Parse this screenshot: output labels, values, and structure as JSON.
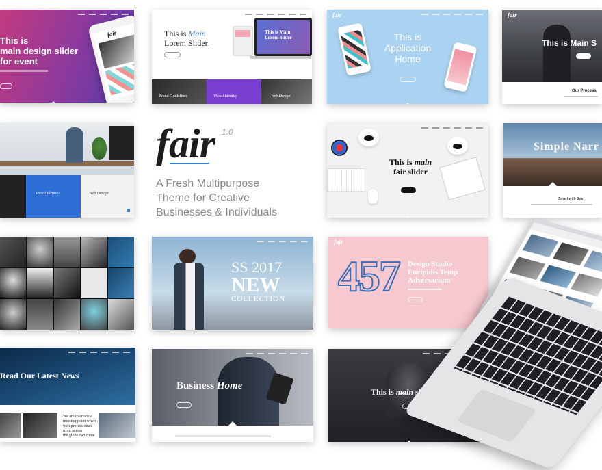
{
  "brand": {
    "name": "fair",
    "version": "1.0",
    "tagline_lines": [
      "A Fresh Multipurpose",
      "Theme for Creative",
      "Businesses & Individuals"
    ]
  },
  "tiles": {
    "t1": {
      "heading_lines": [
        "This is",
        "main design slider",
        "for event"
      ],
      "logo": "fair"
    },
    "t2": {
      "heading_plain": "This is ",
      "heading_italic": "Main",
      "heading_line2": "Lorem Slider_",
      "inner_heading_lines": [
        "This is Main",
        "Lorem Slider"
      ],
      "cards": [
        "Brand Guidelines",
        "Visual Identity",
        "Web Design"
      ]
    },
    "t3": {
      "heading_lines": [
        "This is",
        "Application",
        "Home"
      ],
      "logo": "fair"
    },
    "t4": {
      "heading": "This is Main S",
      "section": "Our Process",
      "logo": "fair"
    },
    "t5": {
      "cards": [
        "Visual Identity",
        "Web Design"
      ]
    },
    "t7": {
      "heading_plain": "This is ",
      "heading_italic": "main",
      "heading_line2": "fair slider"
    },
    "t8": {
      "heading": "Simple Narr",
      "caption": "Smart with Sea"
    },
    "t10": {
      "line1": "SS 2017",
      "line2": "NEW",
      "line3": "COLLECTION"
    },
    "t11": {
      "number": "457",
      "lines": [
        "Design Studio",
        "Euripidis Temp",
        "Adversarium"
      ],
      "logo": "fair"
    },
    "t13": {
      "heading_plain": "Read Our Latest ",
      "heading_italic": "News",
      "text_lines": [
        "We are to create a",
        "meeting point where",
        "web professionals",
        "from across",
        "the globe can come"
      ]
    },
    "t14": {
      "heading_plain": "Business ",
      "heading_italic": "Home"
    },
    "t15": {
      "heading_plain": "This is ",
      "heading_italic": "main",
      "heading_plain2": " slider"
    }
  },
  "colors": {
    "accent_blue": "#3b82d6",
    "pink": "#f6c8cf",
    "sky": "#a9d4f2",
    "gradient_start": "#c03a86",
    "gradient_end": "#5b3aa8"
  }
}
